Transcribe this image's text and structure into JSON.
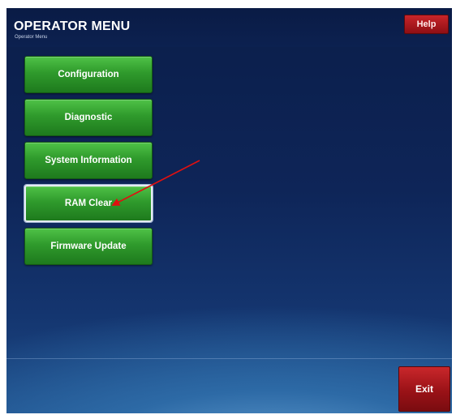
{
  "header": {
    "title": "OPERATOR MENU",
    "subtitle": "Operator Menu",
    "help_label": "Help"
  },
  "menu": {
    "items": [
      {
        "label": "Configuration"
      },
      {
        "label": "Diagnostic"
      },
      {
        "label": "System Information"
      },
      {
        "label": "RAM Clear"
      },
      {
        "label": "Firmware Update"
      }
    ],
    "selected": "RAM Clear"
  },
  "footer": {
    "exit_label": "Exit"
  },
  "colors": {
    "button_green": "#2f9a2c",
    "button_red": "#9a1217",
    "background_navy": "#0e2558",
    "annotation_arrow": "#e01010"
  },
  "icons": {
    "annotation": "red-arrow-icon"
  }
}
